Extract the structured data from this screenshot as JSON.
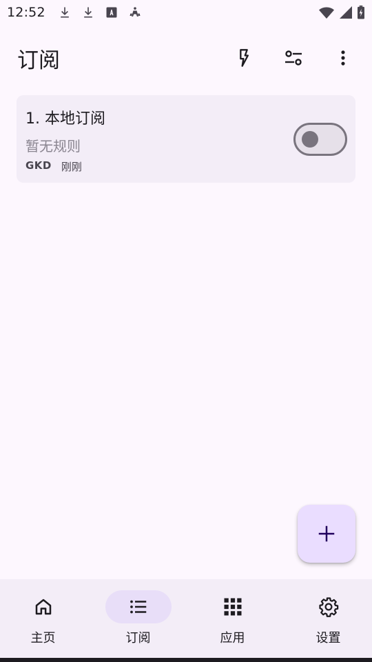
{
  "status_bar": {
    "time": "12:52",
    "icons_left": [
      "download-icon",
      "download-icon",
      "font-a-icon",
      "drone-icon"
    ],
    "icons_right": [
      "wifi-icon",
      "cellular-signal-icon",
      "battery-charging-icon"
    ]
  },
  "app_bar": {
    "title": "订阅",
    "actions": [
      "flash-icon",
      "filter-settings-icon",
      "more-vert-icon"
    ]
  },
  "subscriptions": [
    {
      "title": "1. 本地订阅",
      "subtitle": "暂无规则",
      "author": "GKD",
      "updated": "刚刚",
      "enabled": false
    }
  ],
  "fab": {
    "icon": "plus-icon"
  },
  "bottom_nav": {
    "active": "subs",
    "items": [
      {
        "id": "home",
        "label": "主页",
        "icon": "home-icon"
      },
      {
        "id": "subs",
        "label": "订阅",
        "icon": "list-icon"
      },
      {
        "id": "apps",
        "label": "应用",
        "icon": "grid-apps-icon"
      },
      {
        "id": "settings",
        "label": "设置",
        "icon": "gear-icon"
      }
    ]
  },
  "colors": {
    "background": "#fdf7fe",
    "card": "#f3edf7",
    "fab": "#eaddff",
    "nav_indicator": "#e8def8",
    "outline": "#79747e"
  }
}
